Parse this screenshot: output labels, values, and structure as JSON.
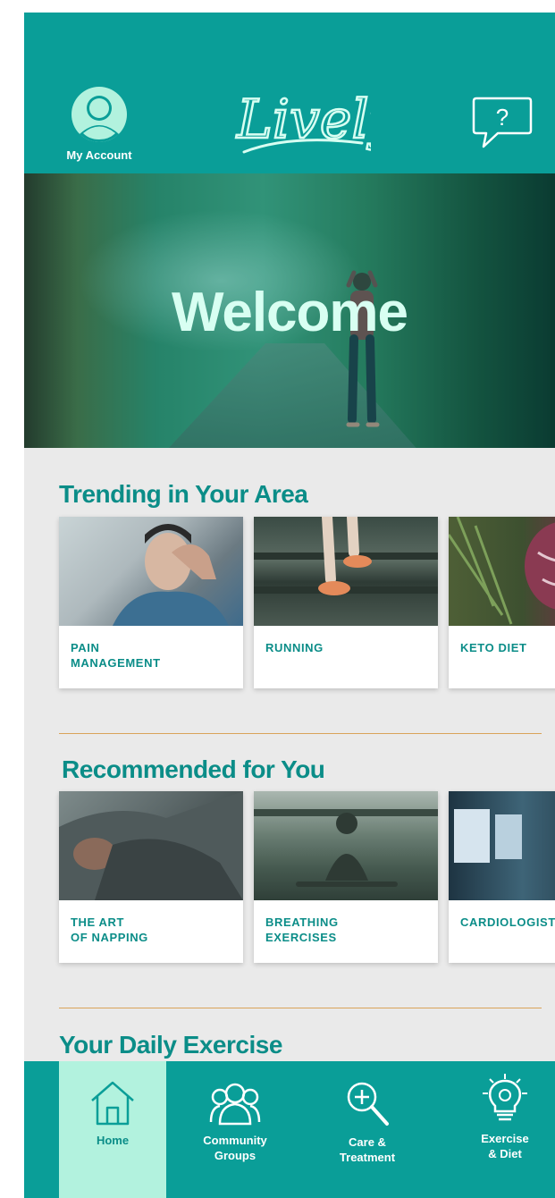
{
  "header": {
    "account_label": "My Account",
    "logo_text": "Lively"
  },
  "hero": {
    "title": "Welcome"
  },
  "sections": {
    "trending": {
      "title": "Trending in Your Area",
      "cards": [
        {
          "label": "PAIN\nMANAGEMENT"
        },
        {
          "label": "RUNNING"
        },
        {
          "label": "KETO DIET"
        }
      ]
    },
    "recommended": {
      "title": "Recommended for You",
      "cards": [
        {
          "label": "THE ART\nOF NAPPING"
        },
        {
          "label": "BREATHING\nEXERCISES"
        },
        {
          "label": "CARDIOLOGIST"
        }
      ]
    },
    "daily": {
      "title": "Your Daily Exercise"
    }
  },
  "nav": {
    "items": [
      {
        "label": "Home",
        "icon": "home-icon",
        "active": true
      },
      {
        "label": "Community\nGroups",
        "icon": "community-icon",
        "active": false
      },
      {
        "label": "Care &\nTreatment",
        "icon": "care-search-icon",
        "active": false
      },
      {
        "label": "Exercise\n& Diet",
        "icon": "lightbulb-gear-icon",
        "active": false
      }
    ]
  },
  "colors": {
    "brand_teal": "#0a9e98",
    "text_teal": "#0b8d88",
    "active_tab": "#b2f2de",
    "divider": "#d9a35a"
  }
}
